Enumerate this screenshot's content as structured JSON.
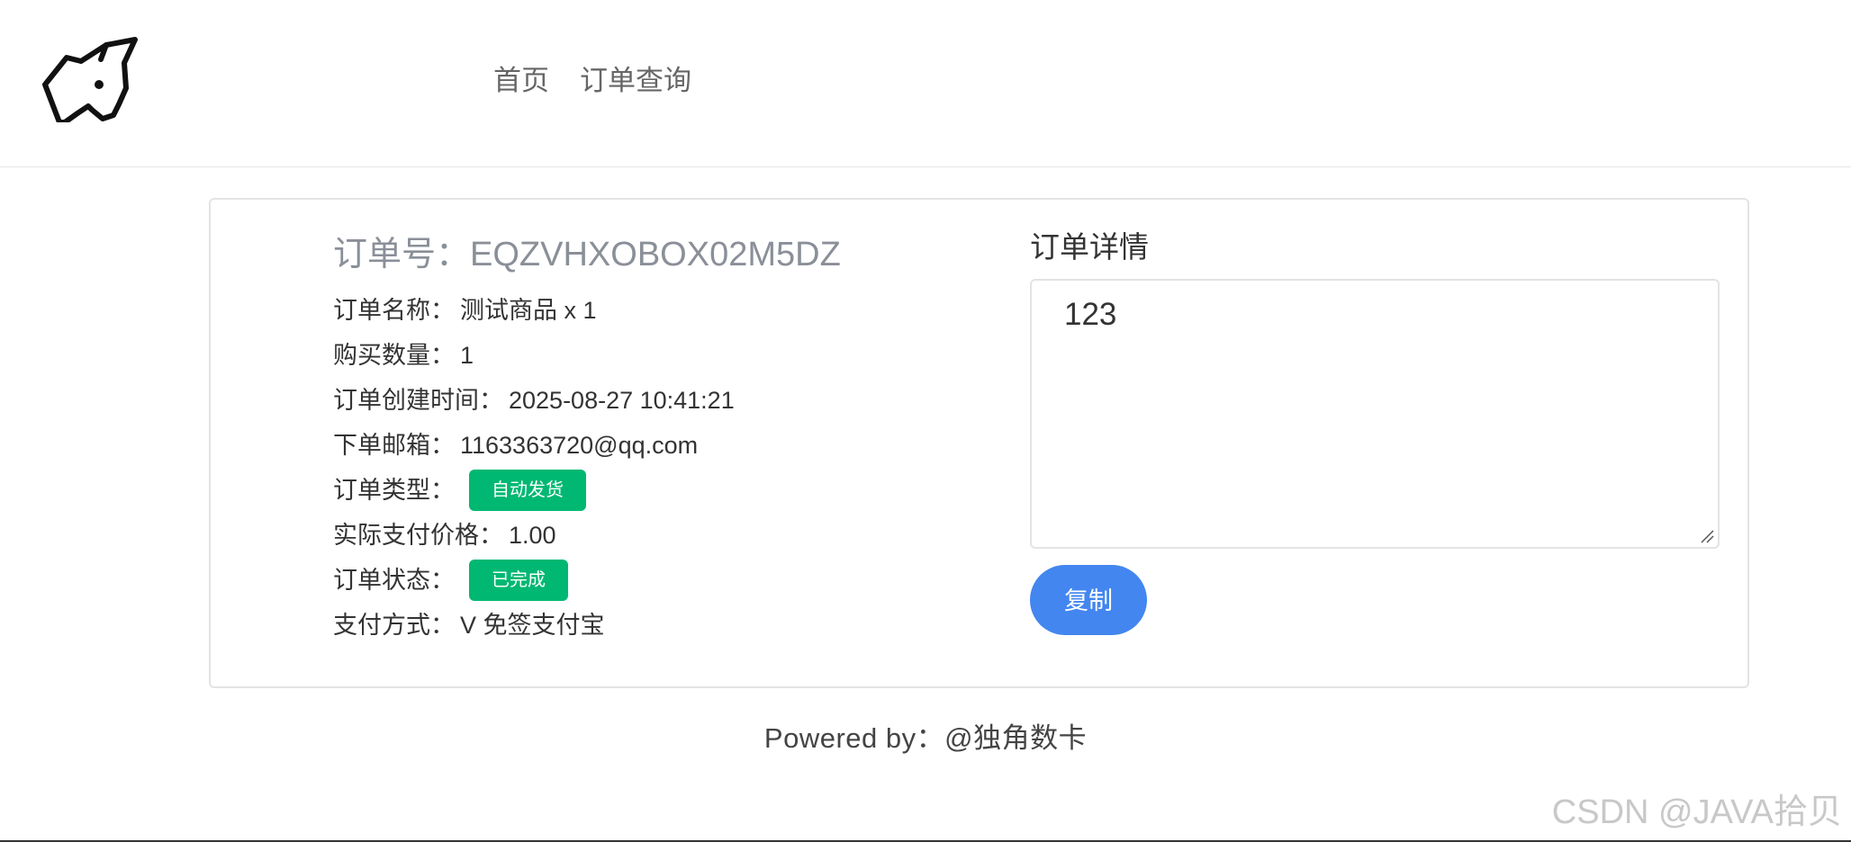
{
  "nav": {
    "home": "首页",
    "order_query": "订单查询"
  },
  "order": {
    "number_label": "订单号：",
    "number": "EQZVHXOBOX02M5DZ",
    "name_label": "订单名称：",
    "name": "测试商品 x 1",
    "quantity_label": "购买数量：",
    "quantity": "1",
    "created_label": "订单创建时间：",
    "created": "2025-08-27 10:41:21",
    "email_label": "下单邮箱：",
    "email": "1163363720@qq.com",
    "type_label": "订单类型：",
    "type_badge": "自动发货",
    "price_label": "实际支付价格：",
    "price": "1.00",
    "status_label": "订单状态：",
    "status_badge": "已完成",
    "payment_label": "支付方式：",
    "payment": "V 免签支付宝"
  },
  "detail": {
    "title": "订单详情",
    "content": "123",
    "copy_label": "复制"
  },
  "footer": {
    "text": "Powered by：@独角数卡"
  },
  "watermark": {
    "text": "CSDN @JAVA拾贝"
  },
  "colors": {
    "badge_green": "#00b871",
    "button_blue": "#4386ef",
    "order_no_gray": "#8a8f98"
  },
  "icons": {
    "logo": "unicorn-head-icon"
  }
}
